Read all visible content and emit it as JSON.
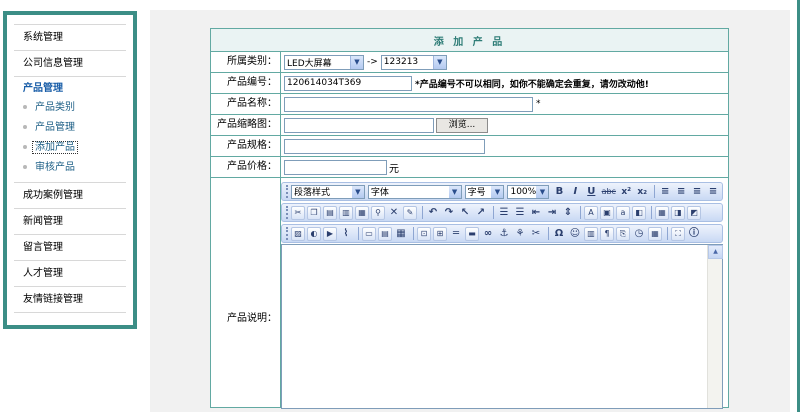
{
  "sidebar": {
    "system": "系统管理",
    "company": "公司信息管理",
    "products": {
      "title": "产品管理",
      "items": [
        "产品类别",
        "产品管理",
        "添加产品",
        "审核产品"
      ]
    },
    "cases": "成功案例管理",
    "news": "新闻管理",
    "messages": "留言管理",
    "talent": "人才管理",
    "links": "友情链接管理"
  },
  "form": {
    "title": "添 加 产 品",
    "category": {
      "label": "所属类别：",
      "primary": "LED大屏幕",
      "arrow": "->",
      "secondary": "123213"
    },
    "code": {
      "label": "产品编号：",
      "value": "120614034T369",
      "hint": "*产品编号不可以相同，如你不能确定会重复，请勿改动他!"
    },
    "name": {
      "label": "产品名称：",
      "value": "",
      "required": "*"
    },
    "thumb": {
      "label": "产品缩略图：",
      "value": "",
      "browse": "浏览..."
    },
    "spec": {
      "label": "产品规格：",
      "value": ""
    },
    "price": {
      "label": "产品价格：",
      "value": "",
      "unit": "元"
    },
    "description": {
      "label": "产品说明："
    }
  },
  "editor": {
    "paragraph_style": "段落样式",
    "font": "字体",
    "size": "字号",
    "zoom": "100%",
    "bold": "B",
    "italic": "I",
    "underline": "U",
    "strike": "abc",
    "superscript": "x²",
    "subscript": "x₂",
    "omega": "Ω"
  },
  "colors": {
    "frame": "#3c8e86",
    "table_border": "#62a9a2",
    "link": "#1a5ea8"
  }
}
